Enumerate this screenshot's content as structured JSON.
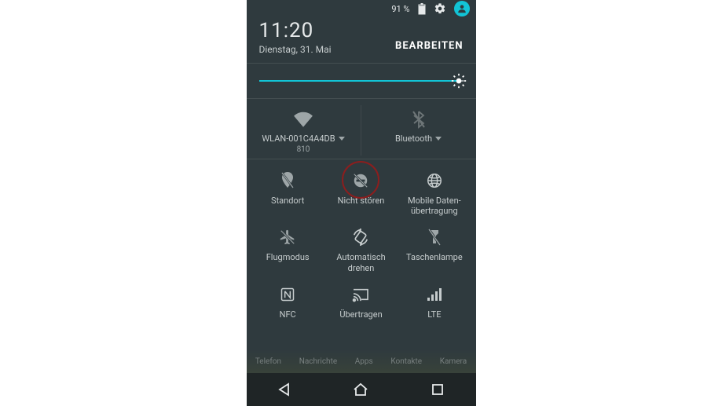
{
  "status_bar": {
    "battery_pct": "91 %"
  },
  "header": {
    "time": "11:20",
    "date": "Dienstag, 31. Mai",
    "edit": "BEARBEITEN"
  },
  "brightness": {
    "value_pct": 98
  },
  "wifi": {
    "label": "WLAN-001C4A4DB",
    "sub": "810"
  },
  "bluetooth": {
    "label": "Bluetooth"
  },
  "tiles": {
    "location": "Standort",
    "dnd": "Nicht stören",
    "data": "Mobile Daten­übertragung",
    "airplane": "Flugmodus",
    "rotate": "Automatisch drehen",
    "flashlight": "Taschenlampe",
    "nfc": "NFC",
    "cast": "Übertragen",
    "lte": "LTE"
  },
  "bg_apps": [
    "Telefon",
    "Nachrichte",
    "Apps",
    "Kontakte",
    "Kamera"
  ]
}
